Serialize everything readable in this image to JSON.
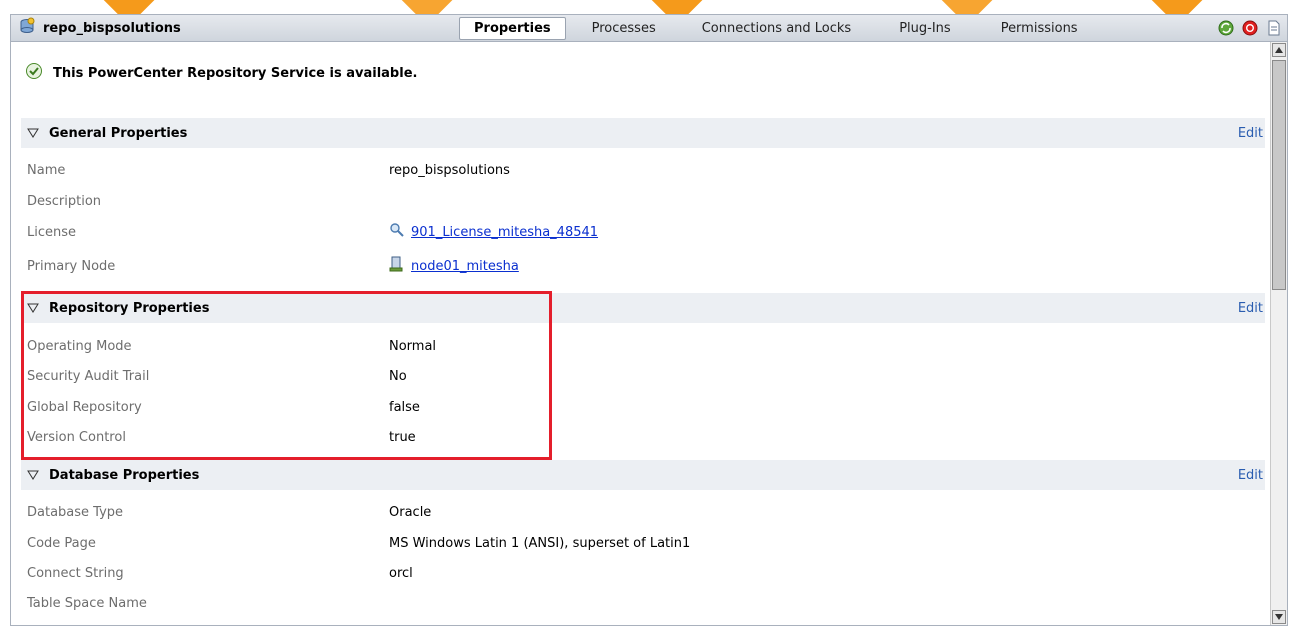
{
  "window": {
    "title": "repo_bispsolutions"
  },
  "tabs": [
    {
      "label": "Properties",
      "active": true
    },
    {
      "label": "Processes",
      "active": false
    },
    {
      "label": "Connections and Locks",
      "active": false
    },
    {
      "label": "Plug-Ins",
      "active": false
    },
    {
      "label": "Permissions",
      "active": false
    }
  ],
  "header_icons": [
    "recycle-icon",
    "stop-icon",
    "document-icon"
  ],
  "status": {
    "icon": "check-circle-icon",
    "text": "This PowerCenter Repository Service is available."
  },
  "sections": {
    "general": {
      "title": "General Properties",
      "edit_label": "Edit",
      "rows": [
        {
          "label": "Name",
          "value": "repo_bispsolutions"
        },
        {
          "label": "Description",
          "value": ""
        },
        {
          "label": "License",
          "value": "901_License_mitesha_48541",
          "icon": "license-key-icon",
          "link": true
        },
        {
          "label": "Primary Node",
          "value": "node01_mitesha",
          "icon": "node-computer-icon",
          "link": true
        }
      ]
    },
    "repository": {
      "title": "Repository Properties",
      "edit_label": "Edit",
      "rows": [
        {
          "label": "Operating Mode",
          "value": "Normal"
        },
        {
          "label": "Security Audit Trail",
          "value": "No"
        },
        {
          "label": "Global Repository",
          "value": "false"
        },
        {
          "label": "Version Control",
          "value": "true"
        }
      ]
    },
    "database": {
      "title": "Database Properties",
      "edit_label": "Edit",
      "rows": [
        {
          "label": "Database Type",
          "value": "Oracle"
        },
        {
          "label": "Code Page",
          "value": "MS Windows Latin 1 (ANSI), superset of Latin1"
        },
        {
          "label": "Connect String",
          "value": "orcl"
        },
        {
          "label": "Table Space Name",
          "value": ""
        }
      ]
    }
  },
  "colors": {
    "highlight_border": "#e41e2b",
    "link": "#0a2fcf",
    "edit_link": "#2a5db0",
    "section_bg": "#eceff3",
    "label_gray": "#6d6d6d"
  }
}
